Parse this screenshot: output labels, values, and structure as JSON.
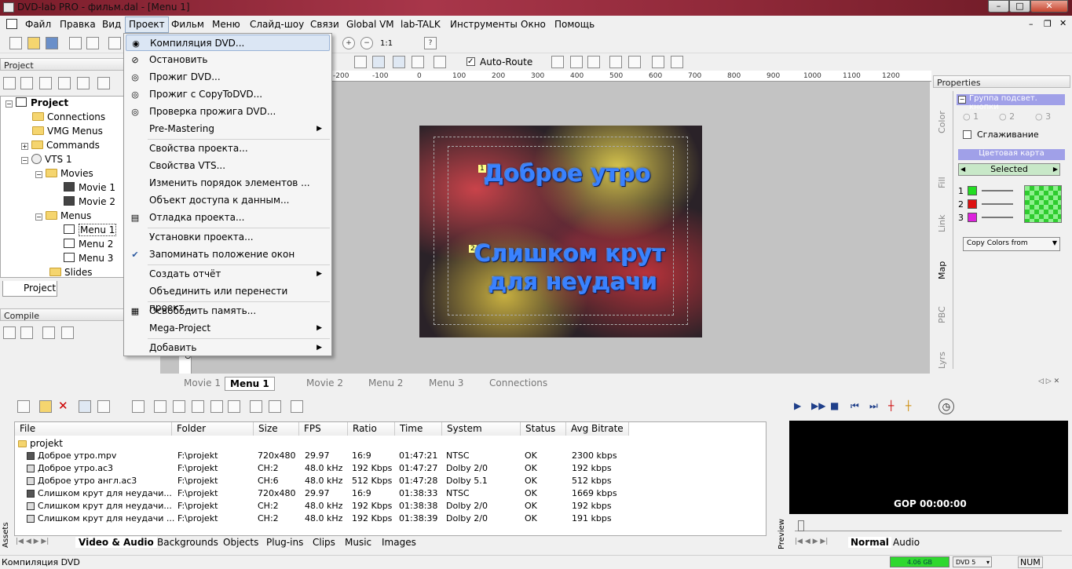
{
  "window": {
    "title": "DVD-lab PRO - фильм.dal - [Menu 1]"
  },
  "menubar": [
    "Файл",
    "Правка",
    "Вид",
    "Проект",
    "Фильм",
    "Меню",
    "Слайд-шоу",
    "Связи",
    "Global VM",
    "lab-TALK",
    "Инструменты",
    "Окно",
    "Помощь"
  ],
  "toolbar": {
    "zoom_label": "1:1",
    "auto_route": "Auto-Route"
  },
  "project_panel": {
    "title": "Project",
    "tab": "Project",
    "tree": [
      "Project",
      "Connections",
      "VMG Menus",
      "Commands",
      "VTS 1",
      "Movies",
      "Movie 1",
      "Movie 2",
      "Menus",
      "Menu 1",
      "Menu 2",
      "Menu 3",
      "Slides"
    ]
  },
  "compile_panel": {
    "title": "Compile"
  },
  "dropdown": {
    "items": [
      "Компиляция DVD...",
      "Остановить",
      "Прожиг DVD...",
      "Прожиг с CopyToDVD...",
      "Проверка прожига DVD...",
      "Pre-Mastering",
      "Свойства проекта...",
      "Свойства VTS...",
      "Изменить порядок элементов ...",
      "Объект доступа к данным...",
      "Отладка проекта...",
      "Установки проекта...",
      "Запоминать положение окон",
      "Создать отчёт",
      "Объединить или перенести проект...",
      "Освободить память...",
      "Mega-Project",
      "Добавить"
    ]
  },
  "ruler": {
    "ticks": [
      "-200",
      "-100",
      "0",
      "100",
      "200",
      "300",
      "400",
      "500",
      "600",
      "700",
      "800",
      "900",
      "1000",
      "1100",
      "1200"
    ],
    "vtick": "60"
  },
  "menu_canvas": {
    "marker1": "1",
    "marker2": "2",
    "line1": "Доброе утро",
    "line2": "Слишком крут",
    "line3": "для неудачи"
  },
  "properties": {
    "title": "Properties",
    "group_title": "Группа подсвет. кнопки",
    "radio": [
      "1",
      "2",
      "3"
    ],
    "antialias": "Сглаживание",
    "color_map": "Цветовая карта",
    "selected": "Selected",
    "rows": [
      "1",
      "2",
      "3"
    ],
    "copy_colors": "Copy Colors from",
    "side_tabs": [
      "Color",
      "Fill",
      "Link",
      "Map",
      "PBC",
      "Lyrs"
    ],
    "colors": {
      "row1": "#22dd22",
      "row2": "#dd1111",
      "row3": "#dd22dd"
    }
  },
  "doc_tabs": [
    "Movie 1",
    "Menu 1",
    "Menu 2",
    "Menu 3",
    "Connections",
    "Movie 2"
  ],
  "assets": {
    "side_label": "Assets",
    "columns": [
      "File",
      "Folder",
      "Size",
      "FPS",
      "Ratio",
      "Time",
      "System",
      "Status",
      "Avg Bitrate"
    ],
    "folder": "projekt",
    "rows": [
      [
        "Доброе утро.mpv",
        "F:\\projekt",
        "720x480",
        "29.97",
        "16:9",
        "01:47:21",
        "NTSC",
        "OK",
        "2300 kbps"
      ],
      [
        "Доброе утро.ac3",
        "F:\\projekt",
        "CH:2",
        "48.0 kHz",
        "192 Kbps",
        "01:47:27",
        "Dolby 2/0",
        "OK",
        "192 kbps"
      ],
      [
        "Доброе утро англ.ac3",
        "F:\\projekt",
        "CH:6",
        "48.0 kHz",
        "512 Kbps",
        "01:47:28",
        "Dolby 5.1",
        "OK",
        "512 kbps"
      ],
      [
        "Слишком крут для неудачи...",
        "F:\\projekt",
        "720x480",
        "29.97",
        "16:9",
        "01:38:33",
        "NTSC",
        "OK",
        "1669 kbps"
      ],
      [
        "Слишком крут для неудачи...",
        "F:\\projekt",
        "CH:2",
        "48.0 kHz",
        "192 Kbps",
        "01:38:38",
        "Dolby 2/0",
        "OK",
        "192 kbps"
      ],
      [
        "Слишком крут для неудачи ...",
        "F:\\projekt",
        "CH:2",
        "48.0 kHz",
        "192 Kbps",
        "01:38:39",
        "Dolby 2/0",
        "OK",
        "191 kbps"
      ]
    ],
    "tabs": [
      "Video & Audio",
      "Backgrounds",
      "Objects",
      "Plug-ins",
      "Clips",
      "Music",
      "Images"
    ]
  },
  "preview": {
    "side_label": "Preview",
    "gop": "GOP 00:00:00",
    "tabs": [
      "Normal",
      "Audio"
    ]
  },
  "status": {
    "text": "Компиляция DVD",
    "disk": "4.06 GB",
    "dvd": "DVD 5",
    "num": "NUM"
  }
}
